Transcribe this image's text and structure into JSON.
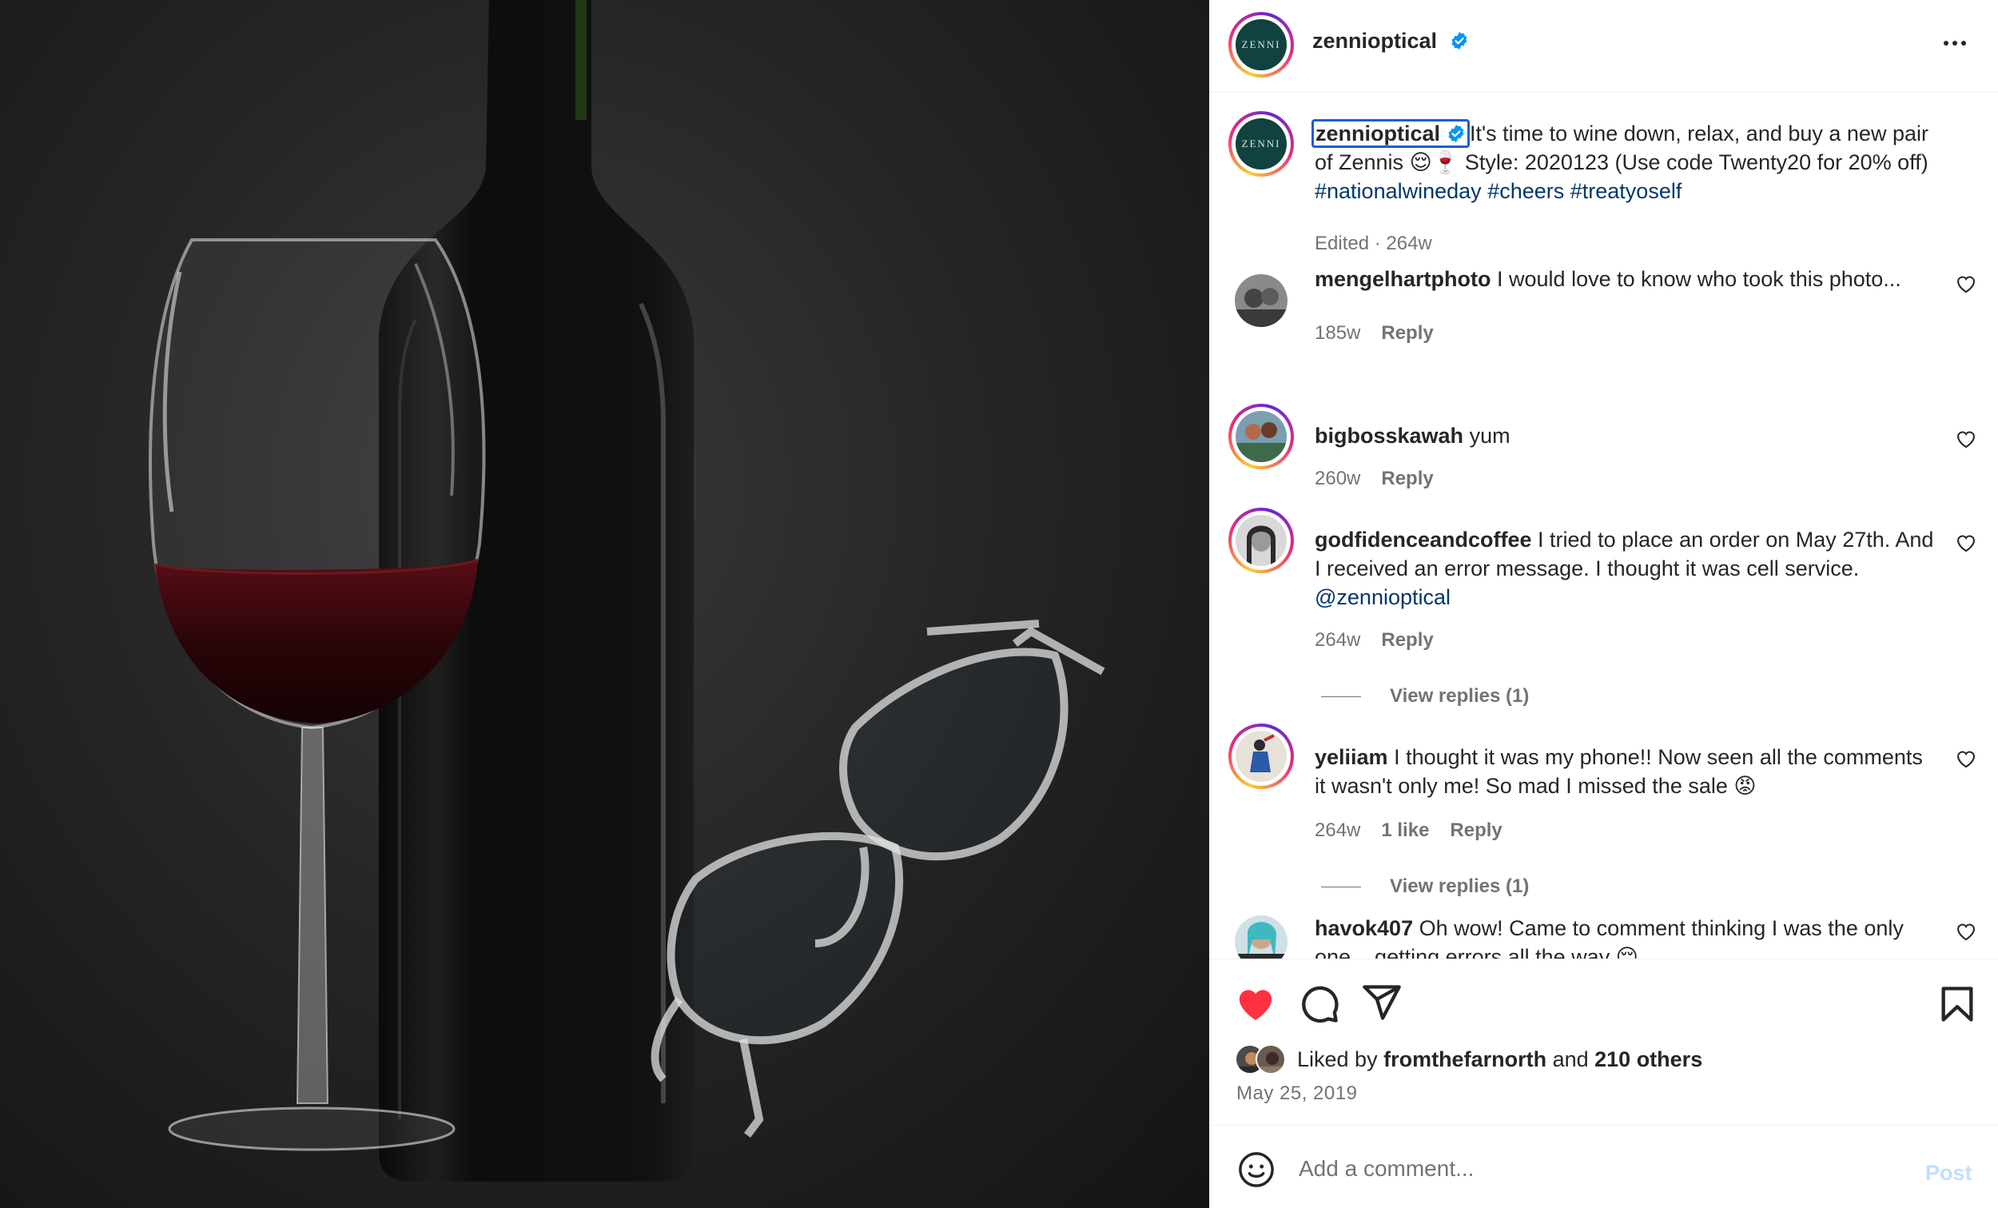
{
  "post": {
    "username": "zennioptical",
    "verified": true,
    "logo_text": "ZENNI",
    "more_icon": "more-horizontal-icon"
  },
  "caption": {
    "username": "zennioptical",
    "text_before": "It's time to wine down, relax, and buy a new pair of Zennis ",
    "emoji_1": "😌",
    "emoji_2": "🍷",
    "text_after": " Style: 2020123 (Use code Twenty20 for 20% off) ",
    "hashtags": [
      "#nationalwineday",
      "#cheers",
      "#treatyoself"
    ],
    "meta": "Edited · 264w"
  },
  "comments": [
    {
      "username": "mengelhartphoto",
      "text": "I would love to know who took this photo...",
      "time": "185w",
      "likes": "",
      "reply_label": "Reply",
      "view_replies": ""
    },
    {
      "username": "bigbosskawah",
      "text": "yum",
      "time": "260w",
      "likes": "",
      "reply_label": "Reply",
      "view_replies": ""
    },
    {
      "username": "godfidenceandcoffee",
      "text": "I tried to place an order on May 27th. And I received an error message. I thought it was cell service. ",
      "mention": "@zennioptical",
      "time": "264w",
      "likes": "",
      "reply_label": "Reply",
      "view_replies": "View replies (1)"
    },
    {
      "username": "yeliiam",
      "text": "I thought it was my phone!! Now seen all the comments it wasn't only me! So mad I missed the sale ",
      "emoji": "😡",
      "time": "264w",
      "likes": "1 like",
      "reply_label": "Reply",
      "view_replies": "View replies (1)"
    },
    {
      "username": "havok407",
      "text": "Oh wow! Came to comment thinking I was the only one... getting errors all the way 😔"
    }
  ],
  "actions": {
    "like_icon": "heart-filled-icon",
    "comment_icon": "comment-icon",
    "share_icon": "paper-plane-icon",
    "save_icon": "bookmark-icon",
    "liked_color": "#ff3040"
  },
  "likes": {
    "prefix": "Liked by ",
    "user": "fromthefarnorth",
    "middle": " and ",
    "others": "210 others"
  },
  "date": "May 25, 2019",
  "comment_box": {
    "placeholder": "Add a comment...",
    "post_label": "Post",
    "emoji_icon": "smiley-icon"
  },
  "colors": {
    "link": "#00376b",
    "muted": "#737373",
    "post_disabled": "#c0dffd",
    "verified": "#0095f6"
  }
}
